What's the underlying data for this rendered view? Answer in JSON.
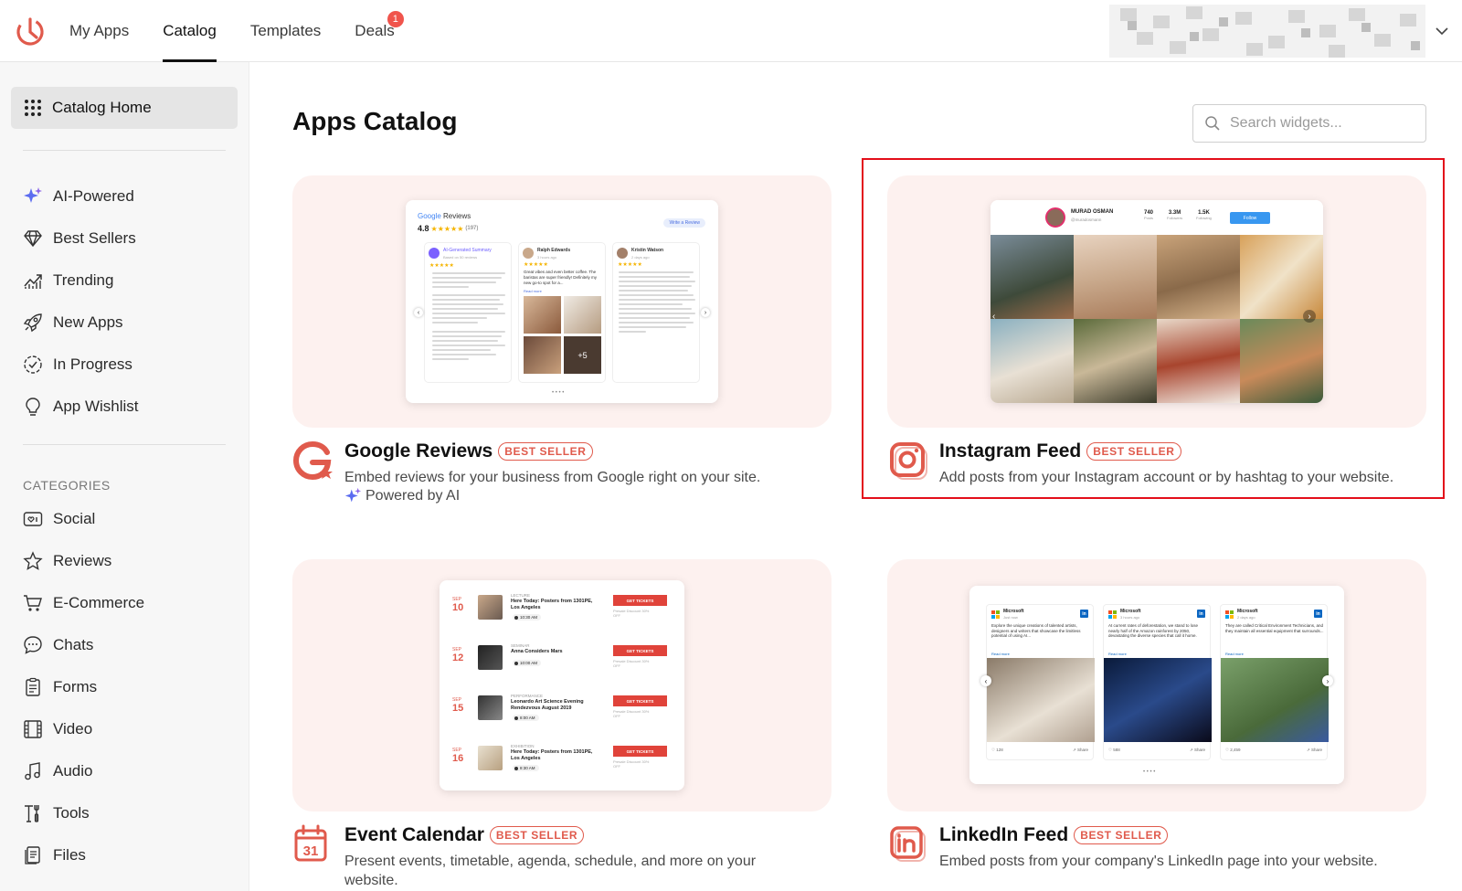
{
  "nav": {
    "items": [
      {
        "label": "My Apps",
        "active": false
      },
      {
        "label": "Catalog",
        "active": true
      },
      {
        "label": "Templates",
        "active": false
      },
      {
        "label": "Deals",
        "active": false,
        "badge": "1"
      }
    ]
  },
  "sidebar": {
    "home_label": "Catalog Home",
    "items": [
      {
        "label": "AI-Powered",
        "icon": "sparkles-icon"
      },
      {
        "label": "Best Sellers",
        "icon": "diamond-icon"
      },
      {
        "label": "Trending",
        "icon": "trending-icon"
      },
      {
        "label": "New Apps",
        "icon": "rocket-icon"
      },
      {
        "label": "In Progress",
        "icon": "progress-check-icon"
      },
      {
        "label": "App Wishlist",
        "icon": "lightbulb-icon"
      }
    ],
    "categories_heading": "CATEGORIES",
    "categories": [
      {
        "label": "Social",
        "icon": "social-icon"
      },
      {
        "label": "Reviews",
        "icon": "star-icon"
      },
      {
        "label": "E-Commerce",
        "icon": "cart-icon"
      },
      {
        "label": "Chats",
        "icon": "chat-icon"
      },
      {
        "label": "Forms",
        "icon": "form-icon"
      },
      {
        "label": "Video",
        "icon": "film-icon"
      },
      {
        "label": "Audio",
        "icon": "music-note-icon"
      },
      {
        "label": "Tools",
        "icon": "tools-icon"
      },
      {
        "label": "Files",
        "icon": "file-icon"
      }
    ]
  },
  "main": {
    "title": "Apps Catalog",
    "search_placeholder": "Search widgets..."
  },
  "apps": [
    {
      "name": "Google Reviews",
      "badge": "BEST SELLER",
      "description": "Embed reviews for your business from Google right on your site.",
      "powered": "Powered by AI",
      "preview": {
        "brand": "Google",
        "title": "Reviews",
        "rating": "4.8",
        "count": "(197)",
        "write_btn": "Write a Review",
        "summary_title": "AI-Generated Summary",
        "summary_sub": "Based on 50 reviews",
        "reviewer1": "Ralph Edwards",
        "reviewer1_time": "3 hours ago",
        "reviewer1_text": "Great vibes and even better coffee. The baristas are super friendly! Definitely my new go-to spot for a...",
        "read_more": "Read more",
        "reviewer2": "Kristin Watson",
        "reviewer2_time": "2 days ago",
        "more_photos": "+5"
      }
    },
    {
      "name": "Instagram Feed",
      "badge": "BEST SELLER",
      "description": "Add posts from your Instagram account or by hashtag to your website.",
      "preview": {
        "username": "MURAD OSMAN",
        "handle": "@muradosmann",
        "posts": "740",
        "posts_label": "Posts",
        "followers": "3.3M",
        "followers_label": "Followers",
        "following": "1.5K",
        "following_label": "Following",
        "follow_btn": "Follow"
      }
    },
    {
      "name": "Event Calendar",
      "badge": "BEST SELLER",
      "description": "Present events, timetable, agenda, schedule, and more on your website.",
      "preview": {
        "events": [
          {
            "month": "SEP",
            "day": "10",
            "type": "LECTURE",
            "title": "Here Today: Posters from 1301PE, Los Angeles",
            "time": "10:30 AM",
            "btn": "GET TICKETS",
            "note": "Presale Discount 30% OFF"
          },
          {
            "month": "SEP",
            "day": "12",
            "type": "SEMINAR",
            "title": "Anna Considers Mars",
            "time": "10:00 AM",
            "btn": "GET TICKETS",
            "note": "Presale Discount 30% OFF"
          },
          {
            "month": "SEP",
            "day": "15",
            "type": "PERFORMANCE",
            "title": "Leonardo Art Science Evening Rendezvous August 2019",
            "time": "8:00 AM",
            "btn": "GET TICKETS",
            "note": "Presale Discount 30% OFF"
          },
          {
            "month": "SEP",
            "day": "16",
            "type": "EXHIBITION",
            "title": "Here Today: Posters from 1301PE, Los Angeles",
            "time": "8:30 AM",
            "btn": "GET TICKETS",
            "note": "Presale Discount 30% OFF"
          }
        ]
      }
    },
    {
      "name": "LinkedIn Feed",
      "badge": "BEST SELLER",
      "description": "Embed posts from your company's LinkedIn page into your website.",
      "preview": {
        "posts": [
          {
            "company": "Microsoft",
            "time": "Just now",
            "text": "Explore the unique creations of talented artists, designers and writers that showcase the limitless potential of using AI...",
            "likes": "128",
            "share": "Share"
          },
          {
            "company": "Microsoft",
            "time": "3 hours ago",
            "text": "At current rates of deforestation, we stand to lose nearly half of the Amazon rainforest by 2050, devastating the diverse species that call it home.",
            "likes": "588",
            "share": "Share"
          },
          {
            "company": "Microsoft",
            "time": "2 days ago",
            "text": "They are called Critical Environment Technicians, and they maintain all essential equipment that surrounds...",
            "likes": "2,459",
            "share": "Share"
          }
        ],
        "read_more": "Read more"
      }
    }
  ],
  "colors": {
    "accent": "#e05a4c",
    "card_bg": "#fdf1ef",
    "highlight": "#e30e1a",
    "badge": "#f0544c"
  }
}
